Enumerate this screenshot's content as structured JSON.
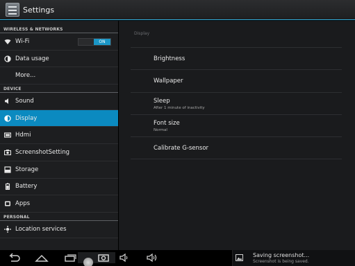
{
  "actionbar": {
    "title": "Settings",
    "icon": "settings-app-icon"
  },
  "left": {
    "sections": [
      {
        "header": "WIRELESS & NETWORKS",
        "items": [
          {
            "label": "Wi-Fi",
            "icon": "wifi-icon",
            "toggle": "ON"
          },
          {
            "label": "Data usage",
            "icon": "data-usage-icon"
          },
          {
            "label": "More...",
            "icon": ""
          }
        ]
      },
      {
        "header": "DEVICE",
        "items": [
          {
            "label": "Sound",
            "icon": "sound-icon"
          },
          {
            "label": "Display",
            "icon": "display-icon",
            "active": true
          },
          {
            "label": "Hdmi",
            "icon": "hdmi-icon"
          },
          {
            "label": "ScreenshotSetting",
            "icon": "camera-icon"
          },
          {
            "label": "Storage",
            "icon": "storage-icon"
          },
          {
            "label": "Battery",
            "icon": "battery-icon"
          },
          {
            "label": "Apps",
            "icon": "apps-icon"
          }
        ]
      },
      {
        "header": "PERSONAL",
        "items": [
          {
            "label": "Location services",
            "icon": "location-icon"
          }
        ]
      }
    ]
  },
  "right": {
    "header": "Display",
    "items": [
      {
        "title": "Brightness",
        "summary": ""
      },
      {
        "title": "Wallpaper",
        "summary": ""
      },
      {
        "title": "Sleep",
        "summary": "After 1 minute of inactivity"
      },
      {
        "title": "Font size",
        "summary": "Normal"
      },
      {
        "title": "Calibrate G-sensor",
        "summary": ""
      }
    ]
  },
  "navbar": {
    "buttons": [
      "back-icon",
      "home-icon",
      "recent-apps-icon",
      "screenshot-icon",
      "volume-down-icon",
      "volume-up-icon"
    ]
  },
  "notification": {
    "title": "Saving screenshot...",
    "subtitle": "Screenshot is being saved.",
    "icon": "image-icon"
  },
  "colors": {
    "accent": "#33b5e5",
    "active_item": "#0b8ac0",
    "toggle_on": "#1b96c6"
  }
}
